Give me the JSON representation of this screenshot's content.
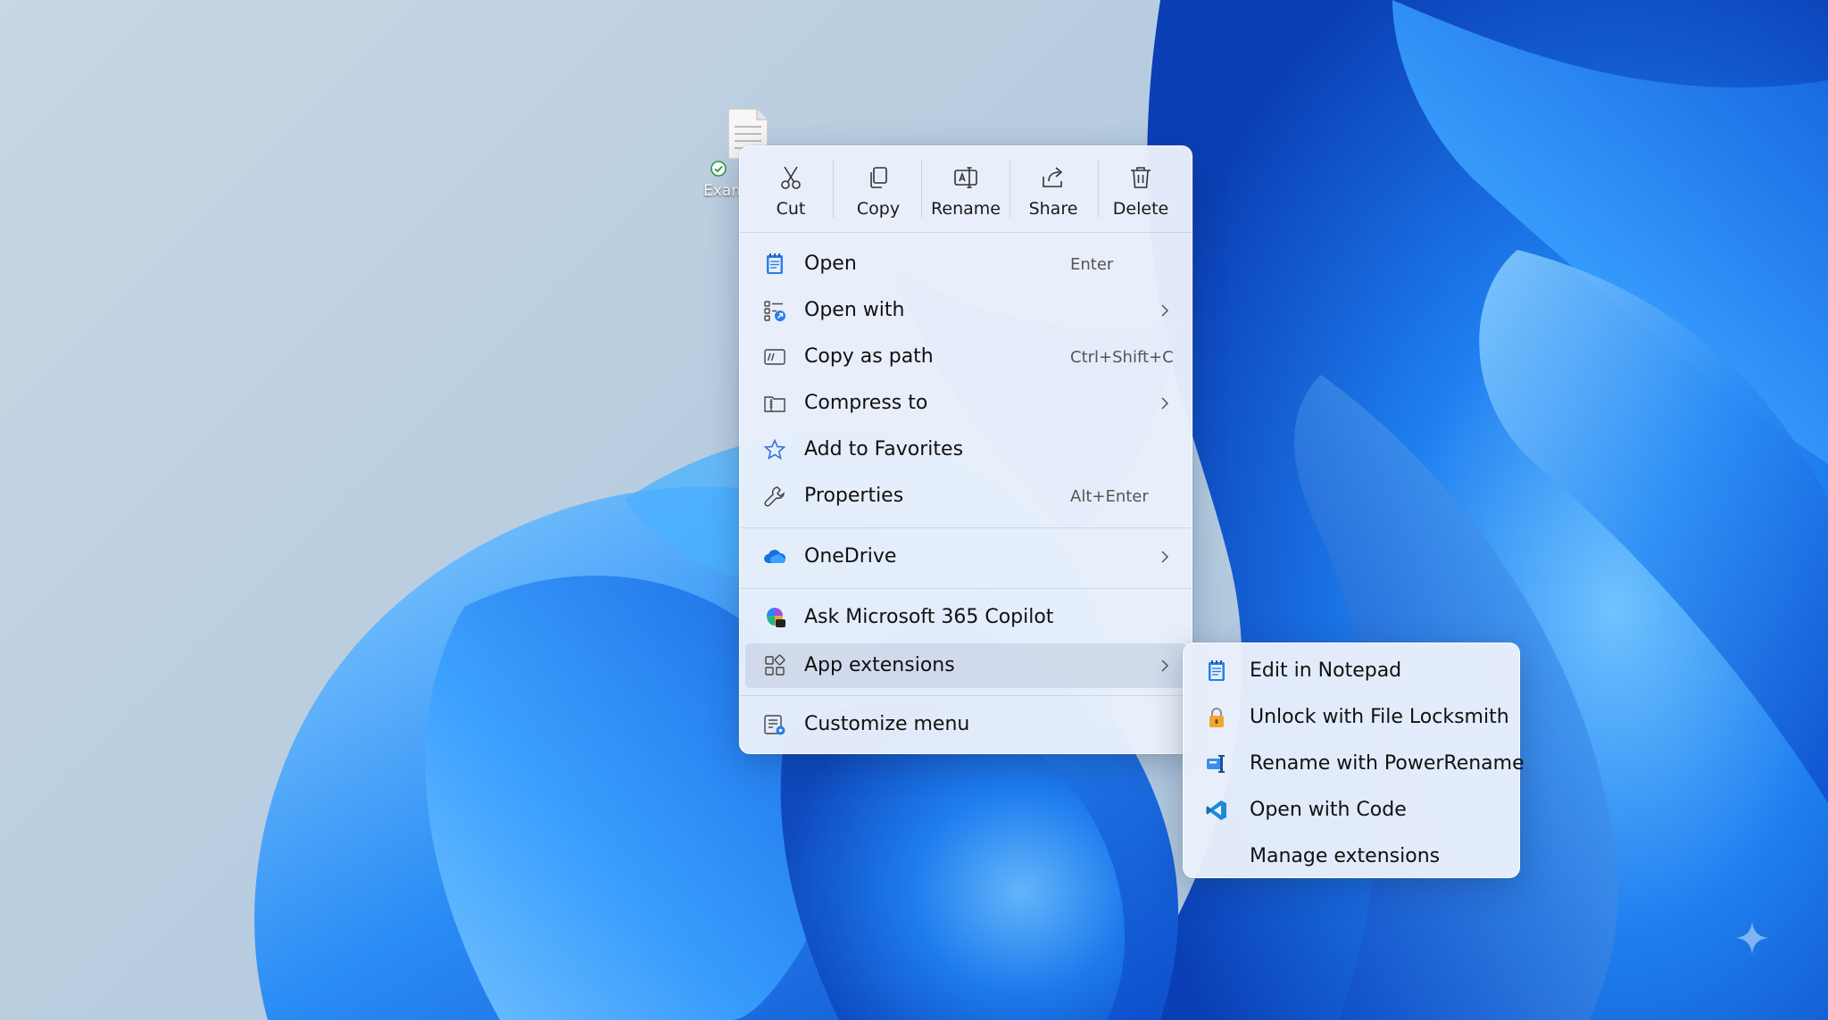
{
  "desktop": {
    "file": {
      "label": "Example.txt",
      "icon": "text-file-icon",
      "badge": "sync-ok-icon"
    }
  },
  "context_menu": {
    "toolbar": [
      {
        "label": "Cut",
        "icon": "scissors-icon"
      },
      {
        "label": "Copy",
        "icon": "copy-icon"
      },
      {
        "label": "Rename",
        "icon": "rename-icon"
      },
      {
        "label": "Share",
        "icon": "share-icon"
      },
      {
        "label": "Delete",
        "icon": "trash-icon"
      }
    ],
    "items": [
      {
        "label": "Open",
        "shortcut": "Enter",
        "icon": "notepad-icon"
      },
      {
        "label": "Open with",
        "has_submenu": true,
        "icon": "open-with-icon"
      },
      {
        "label": "Copy as path",
        "shortcut": "Ctrl+Shift+C",
        "icon": "path-icon"
      },
      {
        "label": "Compress to",
        "has_submenu": true,
        "icon": "archive-icon"
      },
      {
        "label": "Add to Favorites",
        "icon": "star-icon"
      },
      {
        "label": "Properties",
        "shortcut": "Alt+Enter",
        "icon": "wrench-icon"
      },
      {
        "label": "OneDrive",
        "has_submenu": true,
        "icon": "onedrive-cloud-icon"
      },
      {
        "label": "Ask Microsoft 365 Copilot",
        "icon": "copilot-icon"
      },
      {
        "label": "App extensions",
        "has_submenu": true,
        "icon": "app-extensions-icon",
        "active": true
      },
      {
        "label": "Customize menu",
        "icon": "customize-icon"
      }
    ]
  },
  "submenu": {
    "items": [
      {
        "label": "Edit in Notepad",
        "icon": "notepad-icon"
      },
      {
        "label": "Unlock with File Locksmith",
        "icon": "lock-icon"
      },
      {
        "label": "Rename with PowerRename",
        "icon": "powerrename-icon"
      },
      {
        "label": "Open with Code",
        "icon": "vscode-icon"
      },
      {
        "label": "Manage extensions",
        "icon": ""
      }
    ]
  },
  "colors": {
    "accent": "#0067c0",
    "menu_bg": "#e9f0fb",
    "wallpaper_blue": "#1a73e8"
  }
}
